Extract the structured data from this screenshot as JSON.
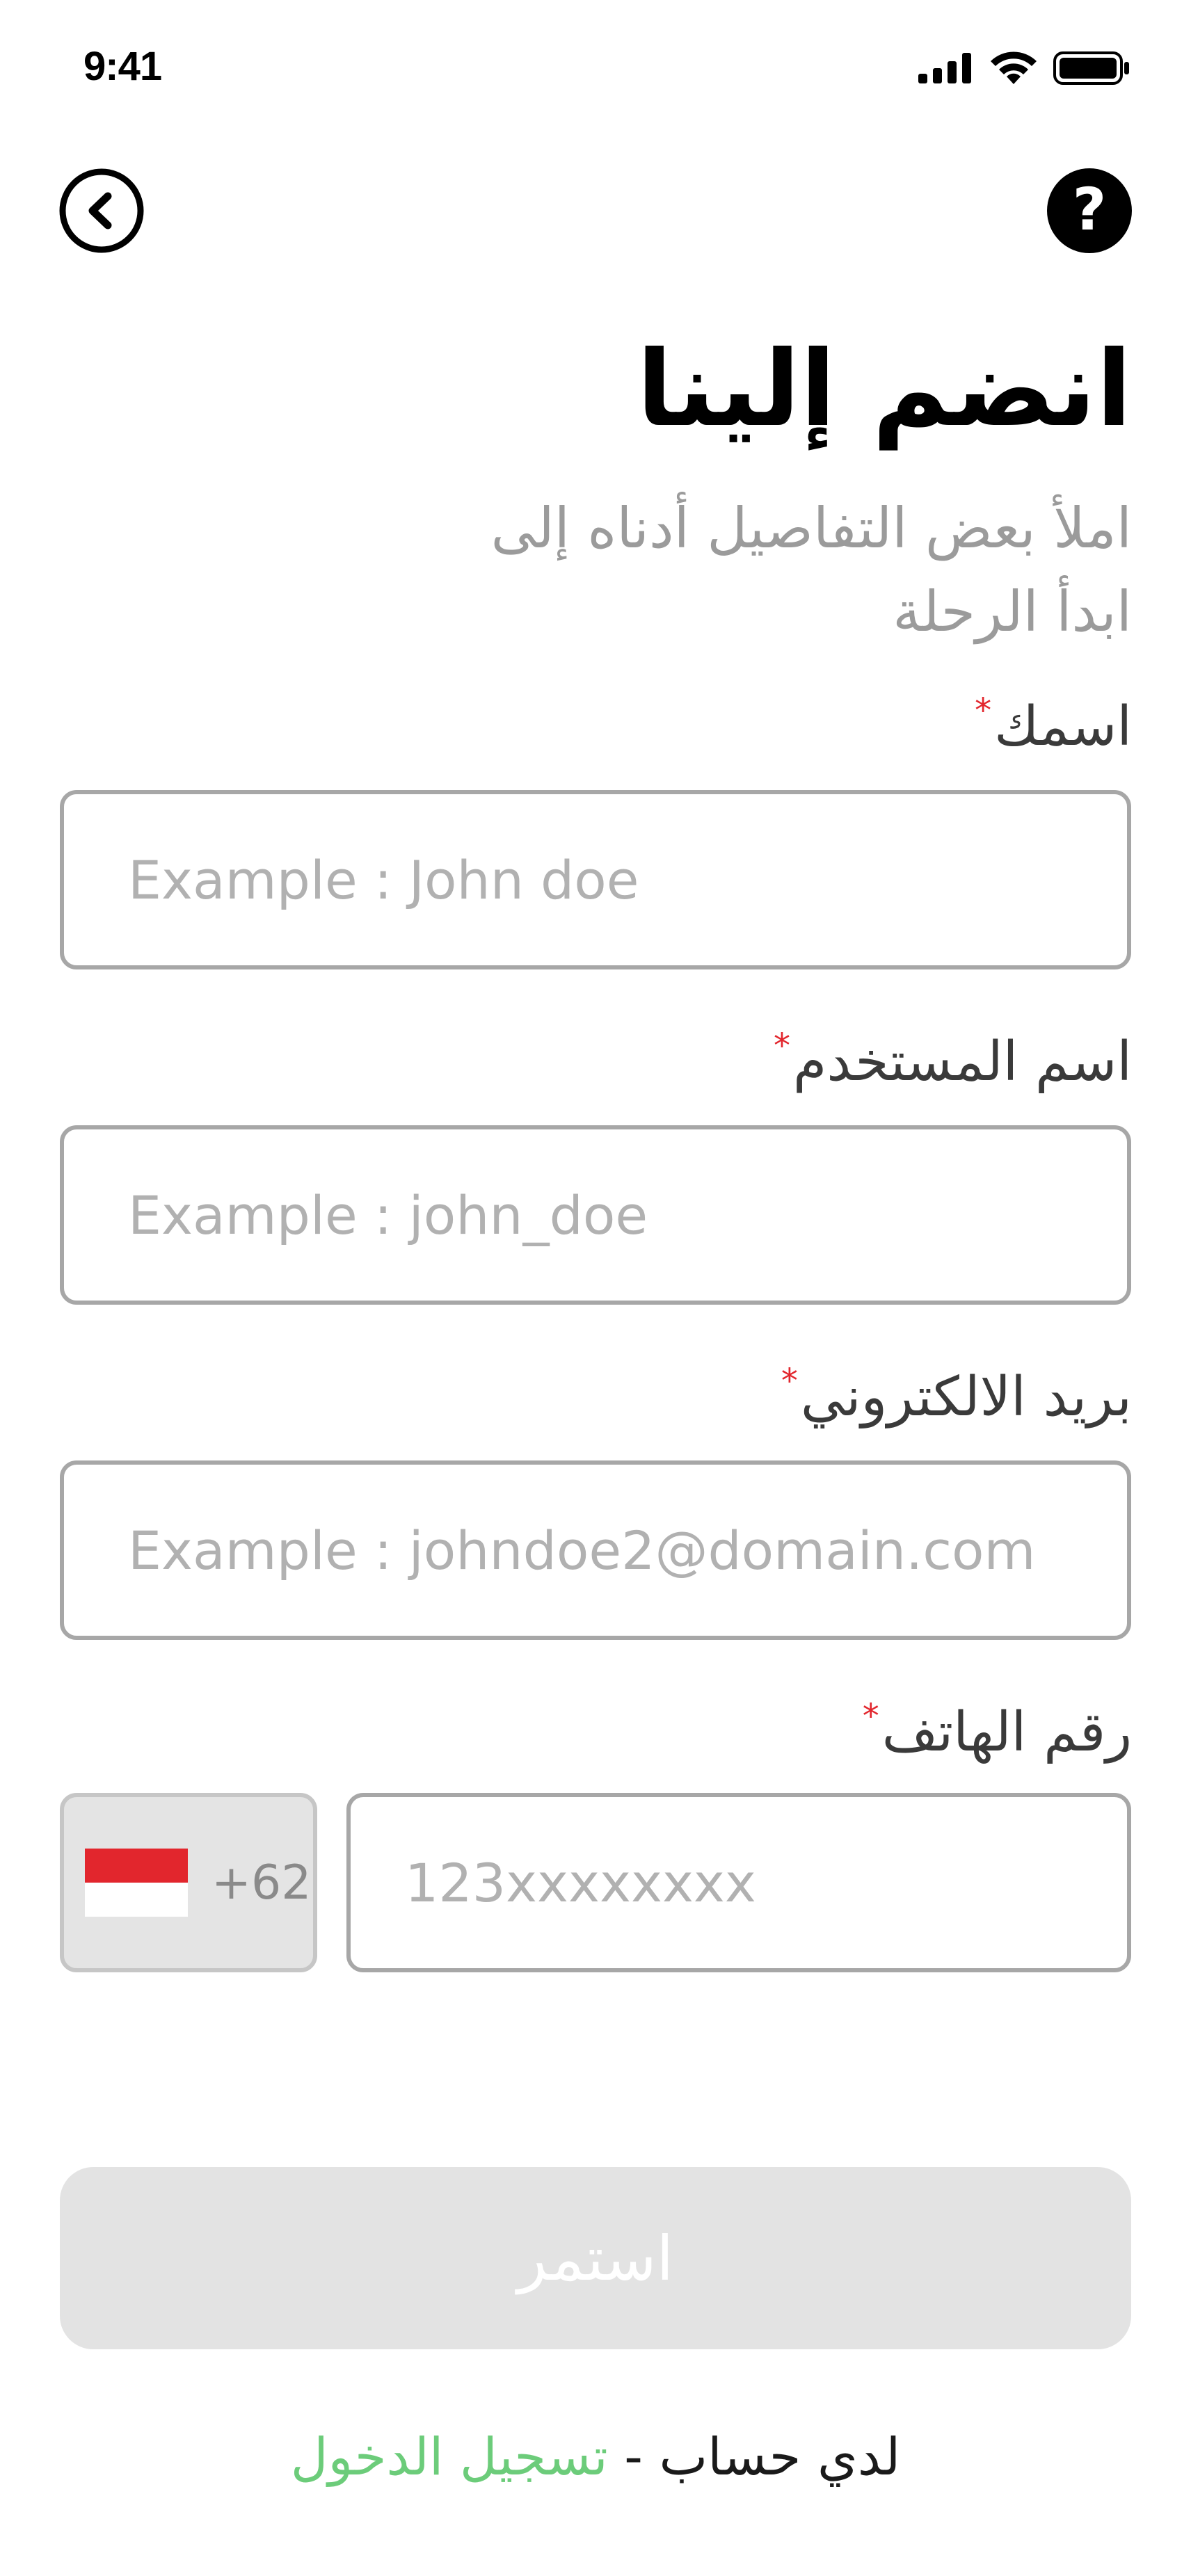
{
  "status_bar": {
    "time": "9:41"
  },
  "header": {
    "title": "انضم إلينا",
    "subtitle_line1": "املأ بعض التفاصيل أدناه إلى",
    "subtitle_line2": "ابدأ الرحلة"
  },
  "form": {
    "name": {
      "label": "اسمك",
      "required": "*",
      "placeholder": "Example : John doe",
      "value": ""
    },
    "username": {
      "label": "اسم المستخدم",
      "required": "*",
      "placeholder": "Example : john_doe",
      "value": ""
    },
    "email": {
      "label": "بريد الالكتروني",
      "required": "*",
      "placeholder": "Example : johndoe2@domain.com",
      "value": ""
    },
    "phone": {
      "label": "رقم الهاتف",
      "required": "*",
      "country_code": "+62",
      "placeholder": "123xxxxxxxx",
      "value": ""
    }
  },
  "actions": {
    "continue_label": "استمر"
  },
  "footer": {
    "text": "لدي حساب",
    "separator": "-",
    "login_link": "تسجيل الدخول"
  },
  "colors": {
    "required": "#e2262d",
    "link": "#6ccc7a",
    "button_disabled": "#e3e3e3"
  },
  "icons": [
    "back-icon",
    "help-icon",
    "signal-icon",
    "wifi-icon",
    "battery-icon",
    "indonesia-flag-icon"
  ]
}
